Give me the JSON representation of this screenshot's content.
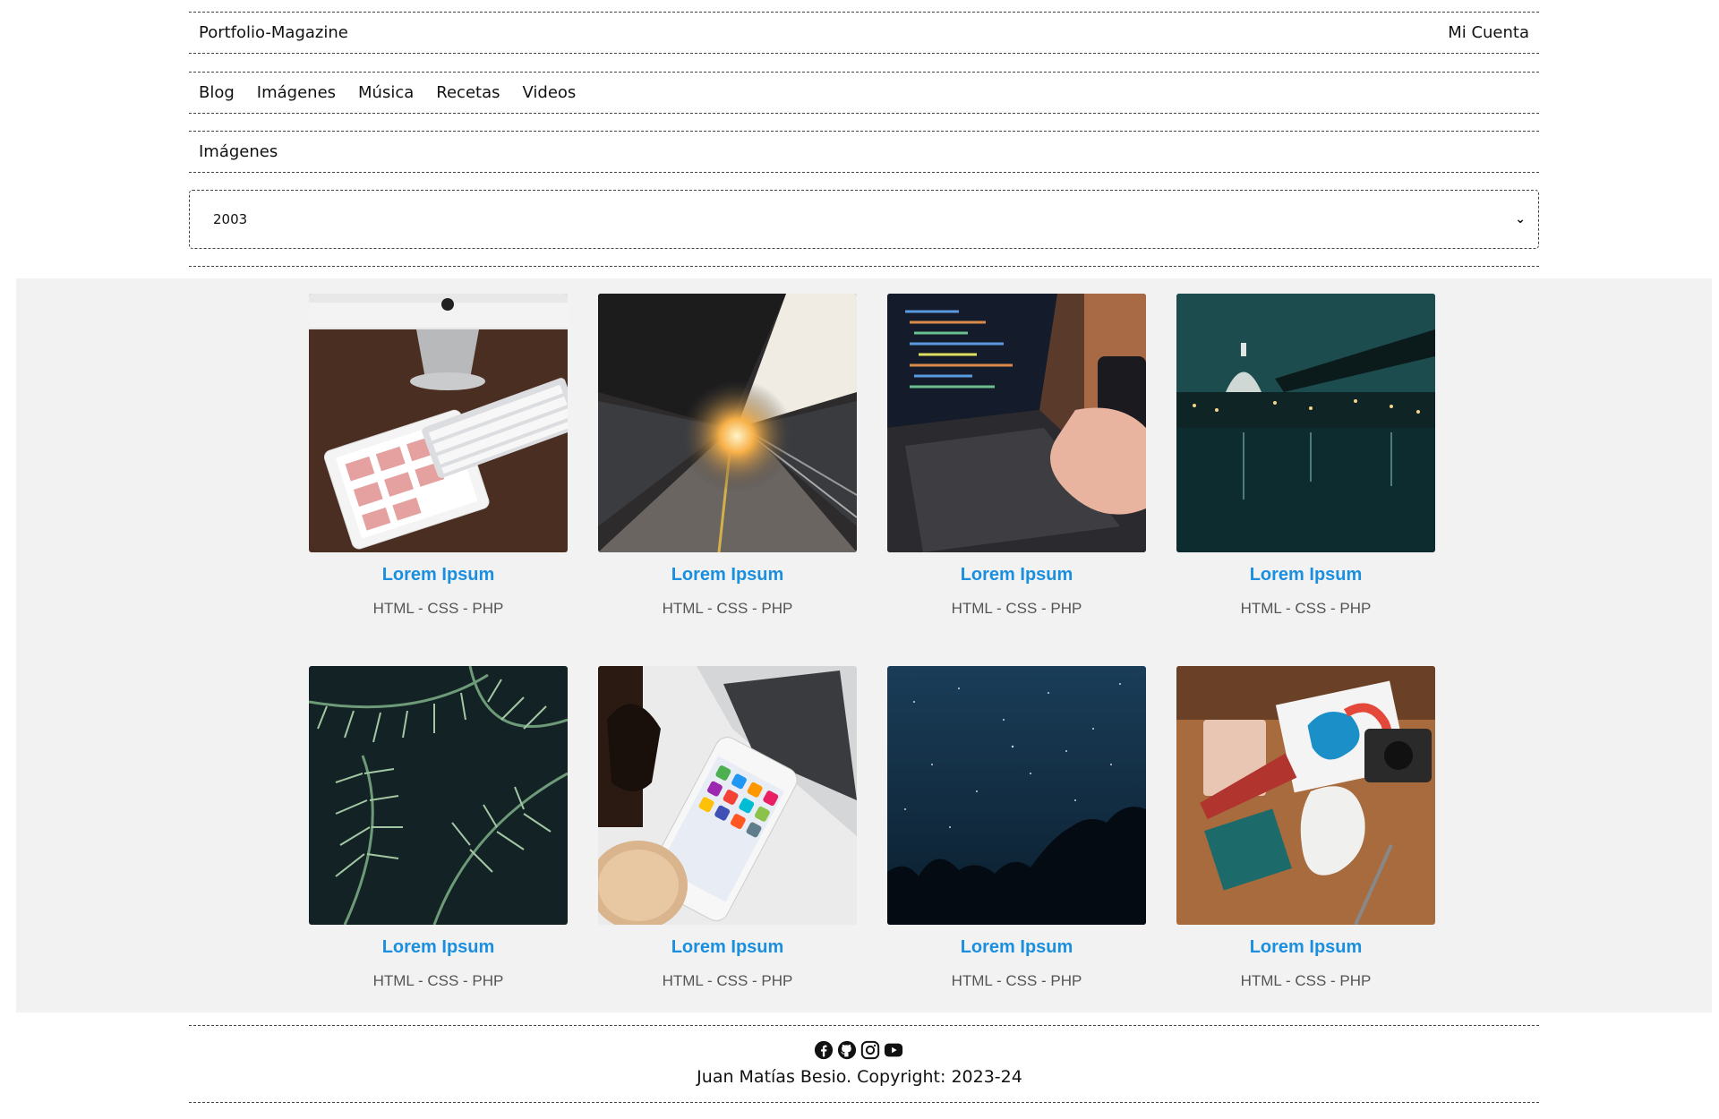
{
  "header": {
    "brand": "Portfolio-Magazine",
    "account_link": "Mi Cuenta"
  },
  "nav": {
    "items": [
      {
        "label": "Blog"
      },
      {
        "label": "Imágenes"
      },
      {
        "label": "Música"
      },
      {
        "label": "Recetas"
      },
      {
        "label": "Videos"
      }
    ]
  },
  "section": {
    "title": "Imágenes"
  },
  "year_select": {
    "selected": "2003"
  },
  "gallery": {
    "cards": [
      {
        "title": "Lorem Ipsum",
        "tags": "HTML - CSS - PHP",
        "image": "desk-imac-ipad-keyboard"
      },
      {
        "title": "Lorem Ipsum",
        "tags": "HTML - CSS - PHP",
        "image": "train-platform-sunset"
      },
      {
        "title": "Lorem Ipsum",
        "tags": "HTML - CSS - PHP",
        "image": "laptop-code-typing"
      },
      {
        "title": "Lorem Ipsum",
        "tags": "HTML - CSS - PHP",
        "image": "city-dome-night-river"
      },
      {
        "title": "Lorem Ipsum",
        "tags": "HTML - CSS - PHP",
        "image": "fern-leaves"
      },
      {
        "title": "Lorem Ipsum",
        "tags": "HTML - CSS - PHP",
        "image": "phone-laptop-coffee"
      },
      {
        "title": "Lorem Ipsum",
        "tags": "HTML - CSS - PHP",
        "image": "starry-night-sky"
      },
      {
        "title": "Lorem Ipsum",
        "tags": "HTML - CSS - PHP",
        "image": "design-desk-flatlay"
      }
    ]
  },
  "footer": {
    "socials": [
      "facebook-icon",
      "github-icon",
      "instagram-icon",
      "youtube-icon"
    ],
    "copyright": "Juan Matías Besio. Copyright: 2023-24"
  },
  "colors": {
    "link": "#1a8fe0",
    "gallery_bg": "#f2f2f2"
  }
}
